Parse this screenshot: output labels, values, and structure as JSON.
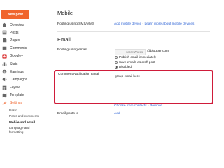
{
  "sidebar": {
    "new_post_label": "New post",
    "items": [
      {
        "label": "Overview",
        "icon": "home-icon"
      },
      {
        "label": "Posts",
        "icon": "posts-icon"
      },
      {
        "label": "Pages",
        "icon": "pages-icon"
      },
      {
        "label": "Comments",
        "icon": "comments-icon"
      },
      {
        "label": "Google+",
        "icon": "googleplus-icon"
      },
      {
        "label": "Stats",
        "icon": "stats-icon"
      },
      {
        "label": "Earnings",
        "icon": "earnings-icon"
      },
      {
        "label": "Campaigns",
        "icon": "campaigns-icon"
      },
      {
        "label": "Layout",
        "icon": "layout-icon"
      },
      {
        "label": "Template",
        "icon": "template-icon"
      },
      {
        "label": "Settings",
        "icon": "wrench-icon"
      }
    ],
    "sub_items": [
      {
        "label": "Basic"
      },
      {
        "label": "Posts and comments"
      },
      {
        "label": "Mobile and email"
      },
      {
        "label": "Language and formatting"
      }
    ]
  },
  "mobile": {
    "title": "Mobile",
    "posting_label": "Posting using SMS/MMS",
    "add_mobile_link": "Add mobile device",
    "separator": " - ",
    "learn_more_link": "Learn more about mobile devices"
  },
  "email": {
    "title": "Email",
    "posting_label": "Posting using email",
    "secret_placeholder": "secretWords",
    "suffix": "@blogger.com",
    "options": [
      {
        "label": "Publish email immediately",
        "selected": false
      },
      {
        "label": "Save emails as draft post",
        "selected": false
      },
      {
        "label": "Disabled",
        "selected": true
      }
    ],
    "notification_label": "Comment Notification Email",
    "notification_value": "group email here",
    "choose_contacts_link": "Choose from contacts",
    "remove_link": "Remove",
    "posts_to_label": "Email posts to",
    "add_link": "Add"
  },
  "colors": {
    "accent": "#f0652d",
    "highlight": "#cf1c3a",
    "link": "#3367d6"
  }
}
